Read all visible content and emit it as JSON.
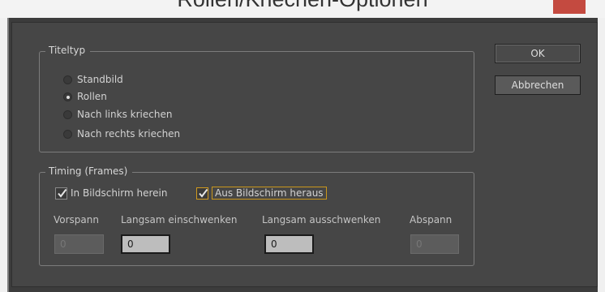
{
  "window": {
    "title": "Rollen/Kriechen-Optionen"
  },
  "title_type_group": {
    "legend": "Titeltyp",
    "options": [
      {
        "label": "Standbild",
        "checked": false
      },
      {
        "label": "Rollen",
        "checked": true
      },
      {
        "label": "Nach links kriechen",
        "checked": false
      },
      {
        "label": "Nach rechts kriechen",
        "checked": false
      }
    ]
  },
  "timing_group": {
    "legend": "Timing (Frames)",
    "checkboxes": [
      {
        "label": "In Bildschirm herein",
        "checked": true
      },
      {
        "label": "Aus Bildschirm heraus",
        "checked": true
      }
    ],
    "fields": [
      {
        "label": "Vorspann",
        "value": "0",
        "enabled": false
      },
      {
        "label": "Langsam einschwenken",
        "value": "0",
        "enabled": true
      },
      {
        "label": "Langsam ausschwenken",
        "value": "0",
        "enabled": true
      },
      {
        "label": "Abspann",
        "value": "0",
        "enabled": false
      }
    ]
  },
  "buttons": {
    "ok": "OK",
    "cancel": "Abbrechen"
  },
  "colors": {
    "close_button": "#c44a40",
    "focus": "#d19a1e",
    "dialog_bg": "#464646"
  },
  "icons": {
    "close": "close-icon",
    "check": "checkmark-icon"
  }
}
